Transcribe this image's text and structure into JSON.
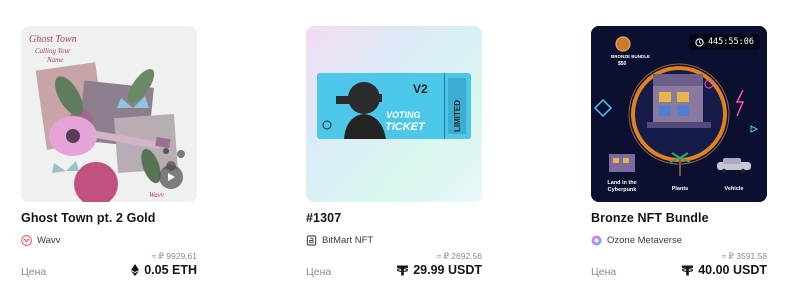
{
  "price_label": "Цена",
  "cards": [
    {
      "title": "Ghost Town pt. 2 Gold",
      "creator": "Wavv",
      "fiat_price": "≈ ₽ 9929.61",
      "price": "0.05 ETH",
      "currency_icon": "ethereum-icon",
      "art": {
        "top_text": "GHOST TOWN",
        "script_text": "CALLING YOUR NAME",
        "signature": "Wavv"
      }
    },
    {
      "title": "#1307",
      "creator": "BitMart NFT",
      "fiat_price": "≈ ₽ 2692.56",
      "price": "29.99 USDT",
      "currency_icon": "tether-icon",
      "art": {
        "ticket_code": "V2",
        "ticket_word1": "VOTING",
        "ticket_word2": "TICKET",
        "ticket_side": "LIMITED"
      }
    },
    {
      "title": "Bronze NFT Bundle",
      "creator": "Ozone Metaverse",
      "fiat_price": "≈ ₽ 3591.58",
      "price": "40.00 USDT",
      "currency_icon": "tether-icon",
      "art": {
        "countdown": "445:55:06",
        "badge": "BRONZE BUNDLE $50",
        "label_land": "Land in the Cyberpunk",
        "label_plants": "Plants",
        "label_vehicle": "Vehicle"
      }
    }
  ],
  "colors": {
    "text": "#151515",
    "muted": "#8a8a8a",
    "wavv_brand": "#d9534f",
    "ticket_cyan": "#3ec3e8"
  }
}
